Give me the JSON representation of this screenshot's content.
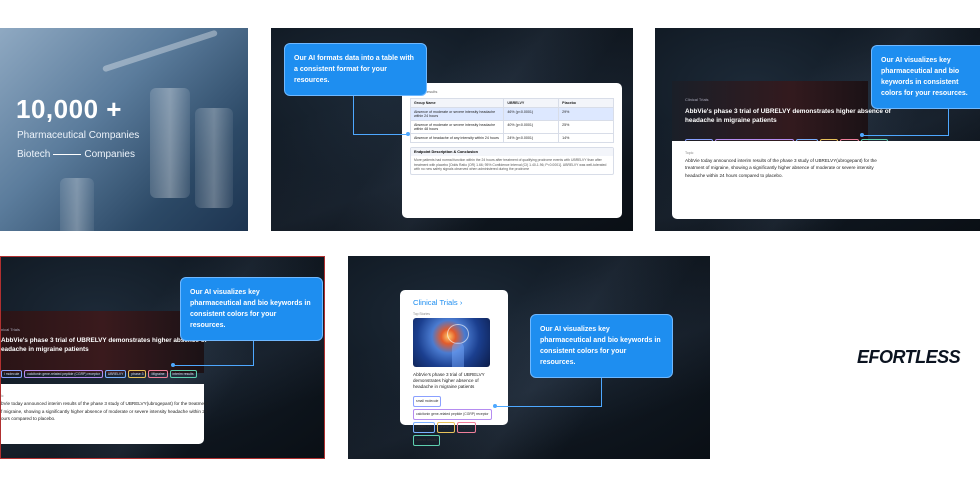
{
  "p1": {
    "big_number": "10,000 +",
    "line1": "Pharmaceutical Companies",
    "biotech": "Biotech",
    "companies": "Companies"
  },
  "p2": {
    "callout": "Our AI formats data into a table with a consistent format for your resources.",
    "section": "Clinical Results",
    "headers": [
      "Group Name",
      "UBRELVY",
      "Placebo"
    ],
    "rows": [
      [
        "Absence of moderate or severe intensity headache within 24 hours",
        "46% (p<0.0001)",
        "29%"
      ],
      [
        "Absence of moderate or severe intensity headache within 48 hours",
        "40% (p<0.0001)",
        "25%"
      ],
      [
        "Absence of headache of any intensity within 24 hours",
        "24% (p<0.0001)",
        "14%"
      ]
    ],
    "endpoint_title": "Endpoint Description & Conclusion",
    "endpoint_text": "More patients had normal function within the 24 hours after treatment of qualifying prodrome events with UBRELVY than after treatment with placebo [Odds Ratio (OR) 1.66; 95% Confidence Interval (CI) 1.40-1.96; P<0.0001]. UBRELVY was well-tolerated with no new safety signals observed when administered during the prodrome"
  },
  "p3": {
    "callout": "Our AI visualizes key pharmaceutical and bio keywords in consistent colors for your resources.",
    "section": "Clinical Trials",
    "headline": "AbbVie's phase 3 trial of UBRELVY demonstrates higher absence of headache in migraine patients",
    "tags": [
      "small molecule",
      "calcitonin gene-related peptide (CGRP) receptor",
      "UBRELVY",
      "phase 3",
      "Migraine",
      "interim results"
    ],
    "topic_label": "Topic",
    "body": "AbbVie today announced interim results of the phase 3 study of UBRELVY(ubrogepant) for the treatment of migraine, showing a significantly higher absence of moderate or severe intensity headache within 24 hours compared to placebo."
  },
  "p4": {
    "callout": "Our AI visualizes key pharmaceutical and bio keywords in consistent colors for your resources.",
    "section": "nical Trials",
    "headline1": "AbbVie's phase 3 trial of UBRELVY demonstrates higher absence of",
    "headline2": "eadache in migraine patients",
    "tags": [
      "l molecule",
      "calcitonin gene-related peptide (CGRP) receptor",
      "UBRELVY",
      "phase 3",
      "Migraine",
      "interim results"
    ],
    "topic_label": "ic",
    "body1": "bVie today announced interim results of the phase 3 study of UBRELVY(ubrogepant) for the treatment",
    "body2": "f migraine, showing a significantly higher absence of moderate or severe intensity headache within 24",
    "body3": "ours compared to placebo."
  },
  "p5": {
    "callout": "Our AI visualizes key pharmaceutical and bio keywords in consistent colors for your resources.",
    "card_title": "Clinical Trials",
    "chevron": "›",
    "top_stories": "Top Stories",
    "headline": "AbbVie's phase 3 trial of UBRELVY demonstrates higher absence of headache in migraine patients",
    "tags_row1": [
      "small molecule"
    ],
    "tags_row2": [
      "calcitonin gene-related peptide (CGRP) receptor"
    ],
    "tags_row3": [
      "UBRELVY",
      "phase 3",
      "Migraine",
      "interim results"
    ]
  },
  "p6": {
    "logo": "EFORTLESS"
  },
  "colors": {
    "accent": "#1e8ef0",
    "dark_bg": "#0f1721",
    "logo": "#0b1320"
  }
}
